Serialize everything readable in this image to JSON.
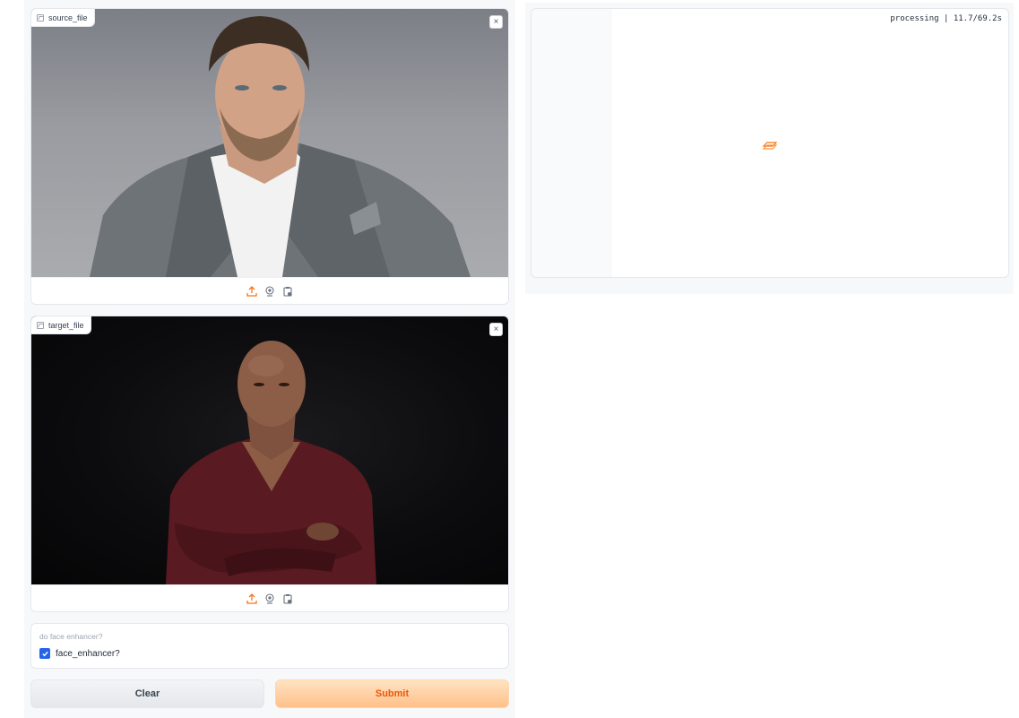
{
  "source": {
    "label": "source_file",
    "close": "×"
  },
  "target": {
    "label": "target_file",
    "close": "×"
  },
  "options": {
    "panel_label": "do face enhancer?",
    "checkbox_label": "face_enhancer?",
    "checked": true
  },
  "buttons": {
    "clear": "Clear",
    "submit": "Submit"
  },
  "output": {
    "status": "processing | 11.7/69.2s"
  },
  "colors": {
    "accent": "#f97316",
    "checkbox": "#2563eb",
    "submit_text": "#ea580c"
  }
}
